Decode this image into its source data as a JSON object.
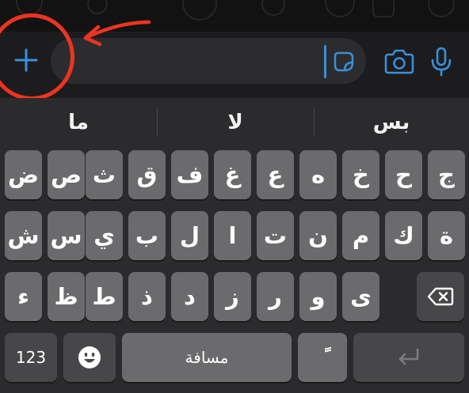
{
  "chat_input": {
    "text": "",
    "icons": {
      "attach": "plus-icon",
      "sticker": "sticker-icon",
      "camera": "camera-icon",
      "mic": "microphone-icon"
    },
    "accent_color": "#3a8fd9"
  },
  "annotation": {
    "color": "#ee3421",
    "shapes": [
      "red-circle",
      "red-arrow"
    ]
  },
  "suggestions": [
    "بس",
    "لا",
    "ما"
  ],
  "keyboard": {
    "row1": [
      "ج",
      "ح",
      "خ",
      "ه",
      "ع",
      "غ",
      "ف",
      "ق",
      "ث",
      "ص",
      "ض"
    ],
    "row2": [
      "ة",
      "ك",
      "م",
      "ن",
      "ت",
      "ا",
      "ل",
      "ب",
      "ي",
      "س",
      "ش"
    ],
    "row3": [
      "ى",
      "و",
      "ر",
      "ز",
      "د",
      "ذ",
      "ط",
      "ظ",
      "ء"
    ],
    "numbers_label": "123",
    "space_label": "مسافة",
    "tanween_label": "ً",
    "icons": {
      "backspace": "backspace-icon",
      "emoji": "emoji-icon",
      "return": "return-icon"
    }
  }
}
